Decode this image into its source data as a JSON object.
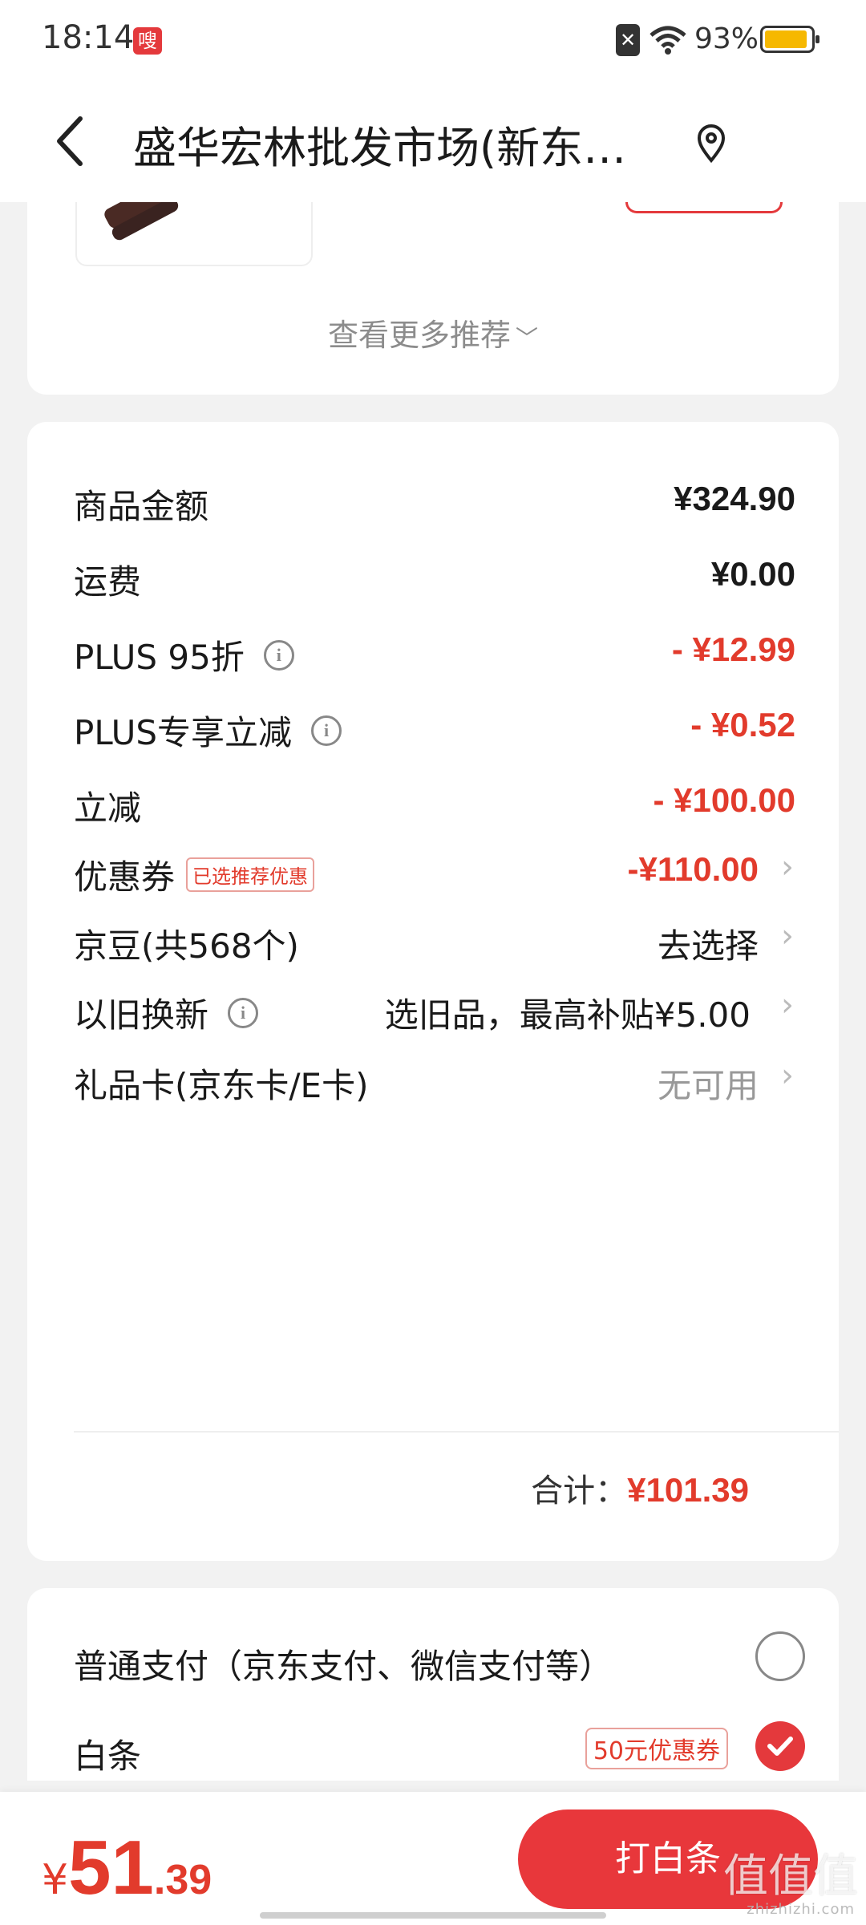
{
  "status_bar": {
    "time": "18:14",
    "app_badge": "嗖",
    "battery": "93%"
  },
  "header": {
    "title": "盛华宏林批发市场(新东…"
  },
  "recommend": {
    "more_label": "查看更多推荐"
  },
  "summary": {
    "rows": [
      {
        "label": "商品金额",
        "value": "¥324.90"
      },
      {
        "label": "运费",
        "value": "¥0.00"
      },
      {
        "label": "PLUS 95折",
        "value": "- ¥12.99"
      },
      {
        "label": "PLUS专享立减",
        "value": "- ¥0.52"
      },
      {
        "label": "立减",
        "value": "- ¥100.00"
      },
      {
        "label": "优惠券",
        "tag": "已选推荐优惠",
        "value": "-¥110.00"
      },
      {
        "label": "京豆(共568个)",
        "value": "去选择"
      },
      {
        "label": "以旧换新",
        "value": "选旧品，最高补贴¥5.00"
      },
      {
        "label": "礼品卡(京东卡/E卡)",
        "value": "无可用"
      }
    ],
    "total_label": "合计：",
    "total_value": "¥101.39"
  },
  "payment": {
    "options": [
      {
        "label": "普通支付（京东支付、微信支付等）",
        "selected": false
      },
      {
        "label": "白条",
        "coupon": "50元优惠券",
        "selected": true
      }
    ]
  },
  "bottom_bar": {
    "currency": "¥",
    "price_int": "51",
    "price_dec": ".39",
    "pay_button": "打白条",
    "watermark": "值值值",
    "watermark_sub": "zhizhizhi.com"
  },
  "colors": {
    "accent": "#e4393c",
    "price_red": "#e23b2c",
    "battery": "#f6b800"
  }
}
